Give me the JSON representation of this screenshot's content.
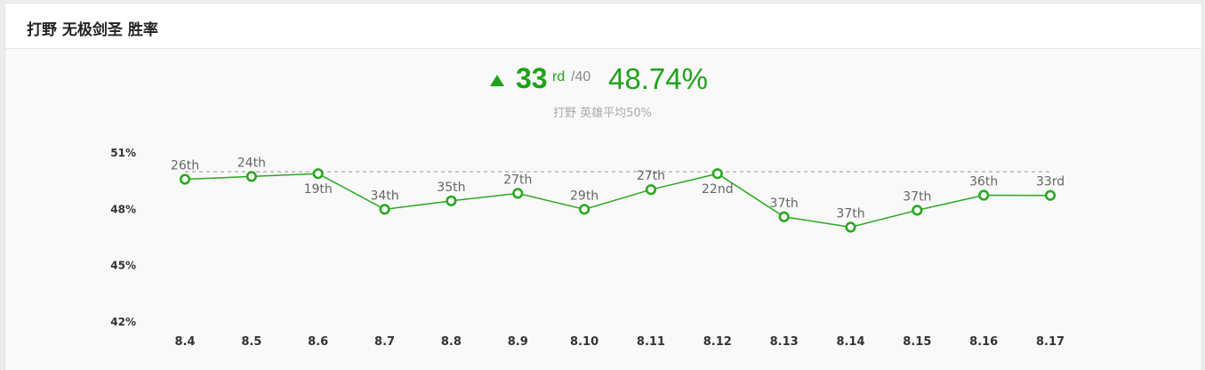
{
  "header": {
    "title": "打野 无极剑圣 胜率"
  },
  "summary": {
    "trend_icon": "triangle-up-icon",
    "rank": "33",
    "rank_suffix": "rd",
    "rank_total": "/40",
    "win_rate": "48.74%",
    "subtitle": "打野 英雄平均50%"
  },
  "colors": {
    "accent": "#1fa21a",
    "line": "#2aa822",
    "average_line": "#a8a8a8"
  },
  "chart_data": {
    "type": "line",
    "categories": [
      "8.4",
      "8.5",
      "8.6",
      "8.7",
      "8.8",
      "8.9",
      "8.10",
      "8.11",
      "8.12",
      "8.13",
      "8.14",
      "8.15",
      "8.16",
      "8.17"
    ],
    "series": [
      {
        "values": [
          49.6,
          49.75,
          49.9,
          48.0,
          48.45,
          48.85,
          48.0,
          49.05,
          49.9,
          47.6,
          47.05,
          47.95,
          48.75,
          48.74
        ]
      }
    ],
    "point_labels": [
      "26th",
      "24th",
      "19th",
      "34th",
      "35th",
      "27th",
      "29th",
      "27th",
      "22nd",
      "37th",
      "37th",
      "37th",
      "36th",
      "33rd"
    ],
    "label_positions": [
      "above",
      "above",
      "below",
      "above",
      "above",
      "above",
      "above",
      "above",
      "below",
      "above",
      "above",
      "above",
      "above",
      "above"
    ],
    "reference_line": {
      "value": 50,
      "style": "dashed"
    },
    "yticks": [
      42,
      45,
      48,
      51
    ],
    "ytick_labels": [
      "42%",
      "45%",
      "48%",
      "51%"
    ],
    "ylim": [
      42,
      51
    ],
    "grid": false,
    "legend": "none"
  }
}
